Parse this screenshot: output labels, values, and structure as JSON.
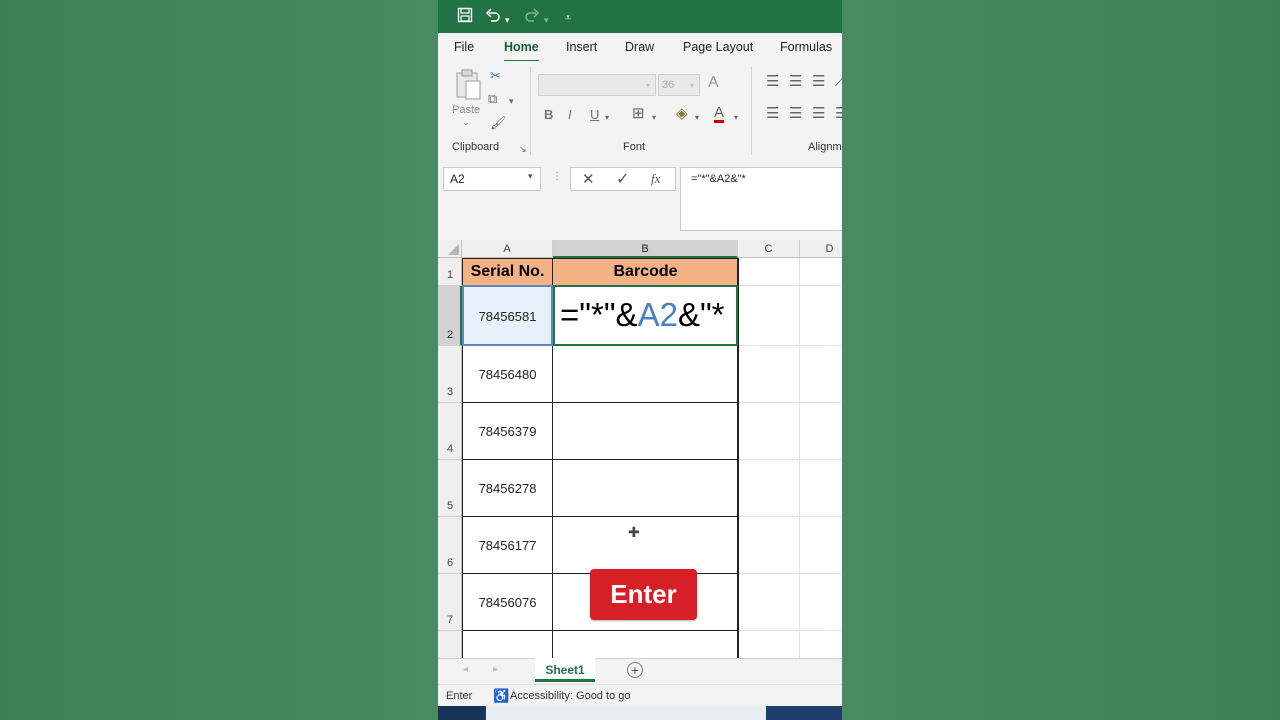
{
  "quick_access": {
    "save_icon": "save-icon",
    "undo_icon": "undo-icon",
    "redo_icon": "redo-icon",
    "customize_icon": "customize-icon"
  },
  "tabs": [
    {
      "label": "File"
    },
    {
      "label": "Home"
    },
    {
      "label": "Insert"
    },
    {
      "label": "Draw"
    },
    {
      "label": "Page Layout"
    },
    {
      "label": "Formulas"
    }
  ],
  "ribbon": {
    "paste_label": "Paste",
    "clipboard_label": "Clipboard",
    "font_label": "Font",
    "alignment_label": "Alignm",
    "font_size": "36",
    "bold": "B",
    "italic": "I",
    "underline": "U"
  },
  "formula_bar": {
    "name_box": "A2",
    "fx": "fx",
    "formula": "=\"*\"&A2&\"*"
  },
  "columns": [
    "A",
    "B",
    "C",
    "D"
  ],
  "rows": [
    "1",
    "2",
    "3",
    "4",
    "5",
    "6",
    "7"
  ],
  "header": {
    "serial": "Serial No.",
    "barcode": "Barcode"
  },
  "serials": [
    "78456581",
    "78456480",
    "78456379",
    "78456278",
    "78456177",
    "78456076"
  ],
  "editing": {
    "prefix": "=\"*\"&",
    "ref": "A2",
    "suffix": "&\"*"
  },
  "overlay": {
    "enter_label": "Enter"
  },
  "sheet": {
    "tab_label": "Sheet1"
  },
  "status": {
    "mode": "Enter",
    "accessibility": "Accessibility: Good to go"
  },
  "colors": {
    "excel_green": "#217346",
    "header_fill": "#f4b183",
    "enter_red": "#d71f27",
    "ref_blue": "#4a7fc9"
  }
}
